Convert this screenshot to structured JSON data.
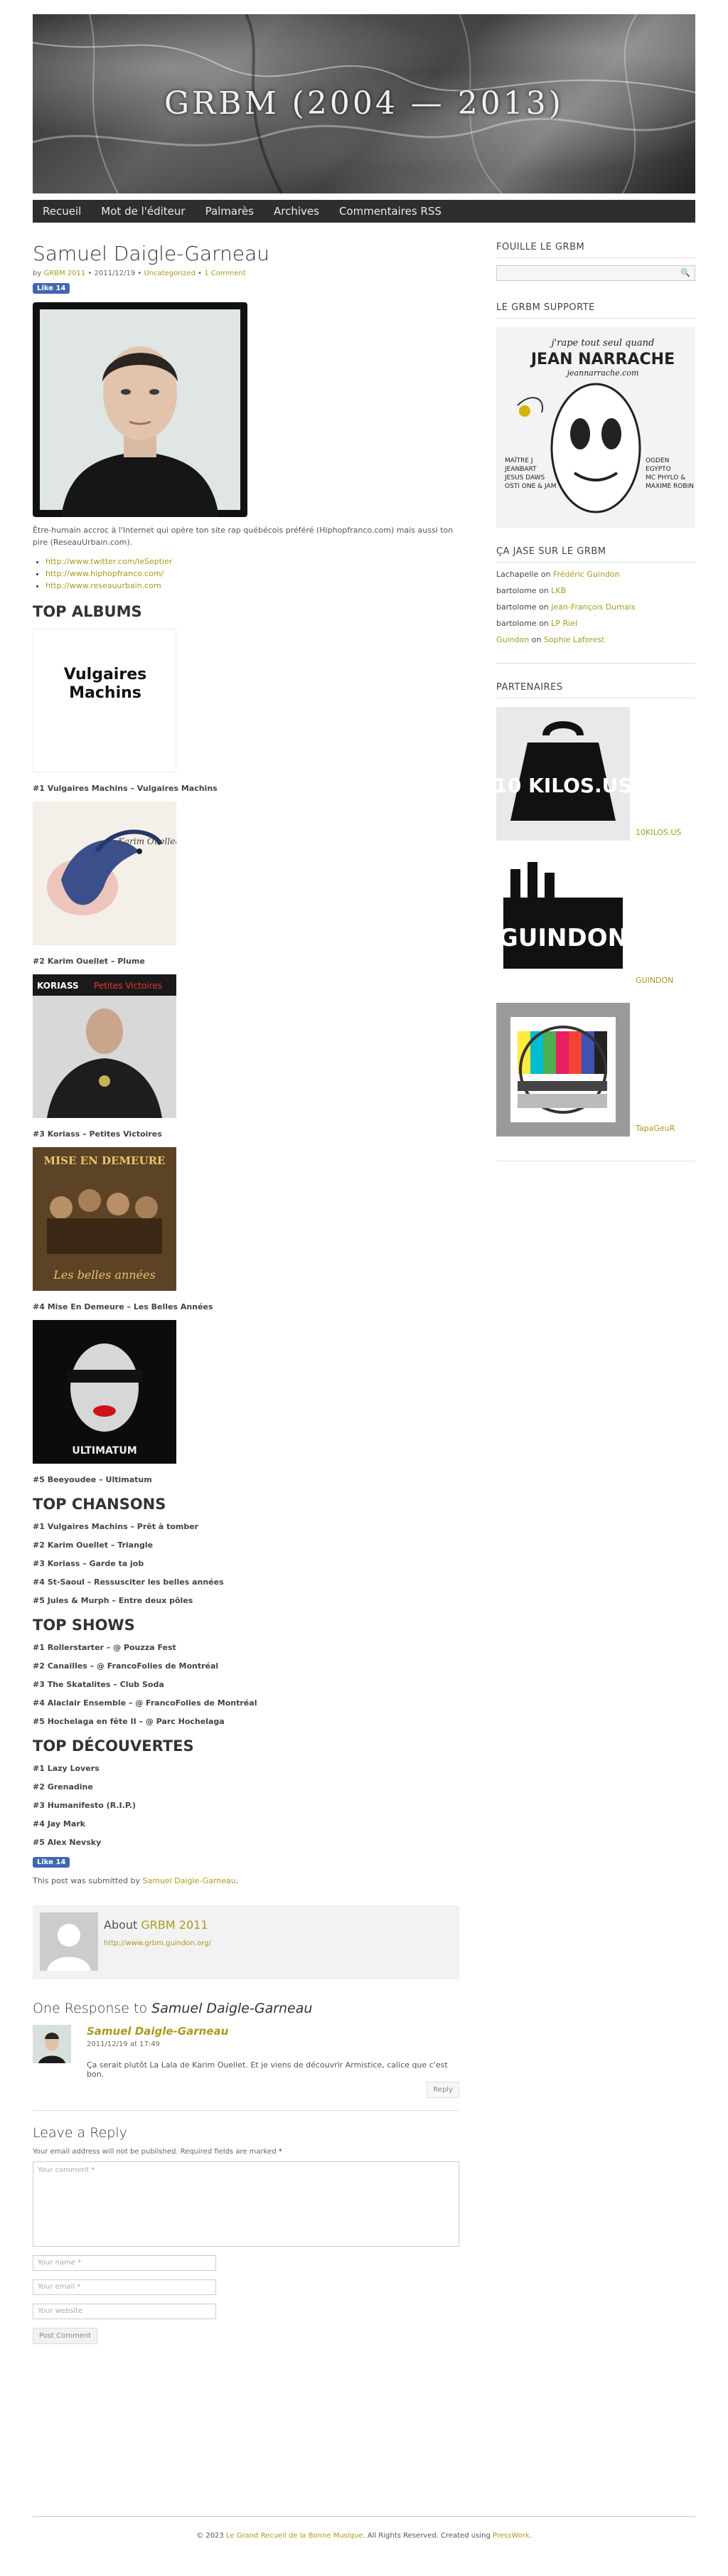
{
  "site": {
    "title": "GRBM (2004 — 2013)"
  },
  "nav": [
    "Recueil",
    "Mot de l'éditeur",
    "Palmarès",
    "Archives",
    "Commentaires RSS"
  ],
  "post": {
    "title": "Samuel Daigle-Garneau",
    "meta_by": "by",
    "meta_author": "GRBM 2011",
    "meta_date": "• 2011/12/19 •",
    "meta_cat": "Uncategorized",
    "meta_sep": "•",
    "meta_comment": "1 Comment",
    "like": "Like 14",
    "intro": "Être-humain accroc à l'Internet qui opère ton site rap québécois préféré (Hiphopfranco.com) mais aussi ton pire (ReseauUrbain.com).",
    "links": [
      "http://www.twitter.com/leSeptier",
      "http://www.hiphopfranco.com/",
      "http://www.reseauurbain.com"
    ],
    "top_albums_h": "TOP ALBUMS",
    "albums": [
      {
        "caption": "#1 Vulgaires Machins – Vulgaires Machins",
        "art_text": "Vulgaires Machins"
      },
      {
        "caption": "#2 Karim Ouellet – Plume",
        "art_text": "Karim Ouellet Plume"
      },
      {
        "caption": "#3 Koriass – Petites Victoires",
        "art_text_a": "KORIASS",
        "art_text_b": "Petites Victoires"
      },
      {
        "caption": "#4 Mise En Demeure – Les Belles Années",
        "art_text_a": "MISE EN DEMEURE",
        "art_text_b": "Les belles années"
      },
      {
        "caption": "#5 Beeyoudee – Ultimatum",
        "art_text": "ULTIMATUM"
      }
    ],
    "top_chansons_h": "TOP CHANSONS",
    "chansons": [
      "#1 Vulgaires Machins – Prêt à tomber",
      "#2 Karim Ouellet – Triangle",
      "#3 Koriass – Garde ta job",
      "#4 St-Saoul – Ressusciter les belles années",
      "#5 Jules & Murph – Entre deux pôles"
    ],
    "top_shows_h": "TOP SHOWS",
    "shows": [
      "#1 Rollerstarter – @ Pouzza Fest",
      "#2 Canailles – @ FrancoFolies de Montréal",
      "#3 The Skatalites – Club Soda",
      "#4 Alaclair Ensemble – @ FrancoFolies de Montréal",
      "#5 Hochelaga en fête II – @ Parc Hochelaga"
    ],
    "top_decouvertes_h": "TOP DÉCOUVERTES",
    "decouvertes": [
      "#1 Lazy Lovers",
      "#2 Grenadine",
      "#3 Humanifesto (R.I.P.)",
      "#4 Jay Mark",
      "#5 Alex Nevsky"
    ],
    "submitted_pre": "This post was submitted by",
    "submitted_name": "Samuel Daigle-Garneau",
    "submitted_post": "."
  },
  "author_box": {
    "about": "About",
    "name": "GRBM 2011",
    "url": "http://www.grbm.guindon.org/"
  },
  "responses": {
    "heading_pre": "One Response to",
    "heading_title": "Samuel Daigle-Garneau"
  },
  "comment": {
    "name": "Samuel Daigle-Garneau",
    "date": "2011/12/19 at 17:49",
    "text": "Ça serait plutôt La Lala de Karim Ouellet. Et je viens de découvrir Armistice, calice que c'est bon.",
    "reply": "Reply"
  },
  "reply_form": {
    "heading": "Leave a Reply",
    "note": "Your email address will not be published. Required fields are marked",
    "star": "*",
    "comment_ph": "Your comment *",
    "name_ph": "Your name *",
    "email_ph": "Your email *",
    "website_ph": "Your website",
    "submit": "Post Comment"
  },
  "sidebar": {
    "search_h": "FOUILLE LE GRBM",
    "support_h": "LE GRBM SUPPORTE",
    "jean": {
      "line1": "j'rape tout seul quand",
      "line2": "JEAN NARRACHE",
      "line3": "jeannarrache.com",
      "left": [
        "MAÎTRE J",
        "JEANBART",
        "JESUS DAWS",
        "OSTI ONE & JAM"
      ],
      "right": [
        "OGDEN",
        "EGYPTO",
        "MC PHYLO &",
        "MAXIME ROBIN"
      ]
    },
    "jase_h": "ÇA JASE SUR LE GRBM",
    "recent": [
      {
        "who": "Lachapelle",
        "on": "on",
        "post": "Frédéric Guindon"
      },
      {
        "who": "bartolome",
        "on": "on",
        "post": "LKB"
      },
      {
        "who": "bartolome",
        "on": "on",
        "post": "Jean-François Dumais"
      },
      {
        "who": "bartolome",
        "on": "on",
        "post": "LP Riel"
      },
      {
        "who": "Guindon",
        "on": "on",
        "post": "Sophie Laforest"
      }
    ],
    "partners_h": "PARTENAIRES",
    "partners": [
      {
        "name": "10KILOS.US",
        "art": "10 KILOS.US"
      },
      {
        "name": "GUINDON",
        "art": "GUINDON"
      },
      {
        "name": "TapaGeuR",
        "art": ""
      }
    ]
  },
  "footer": {
    "pre": "© 2023",
    "site": "Le Grand Recueil de la Bonne Musique",
    "mid": ". All Rights Reserved. Created using",
    "theme": "PressWork",
    "post": "."
  }
}
